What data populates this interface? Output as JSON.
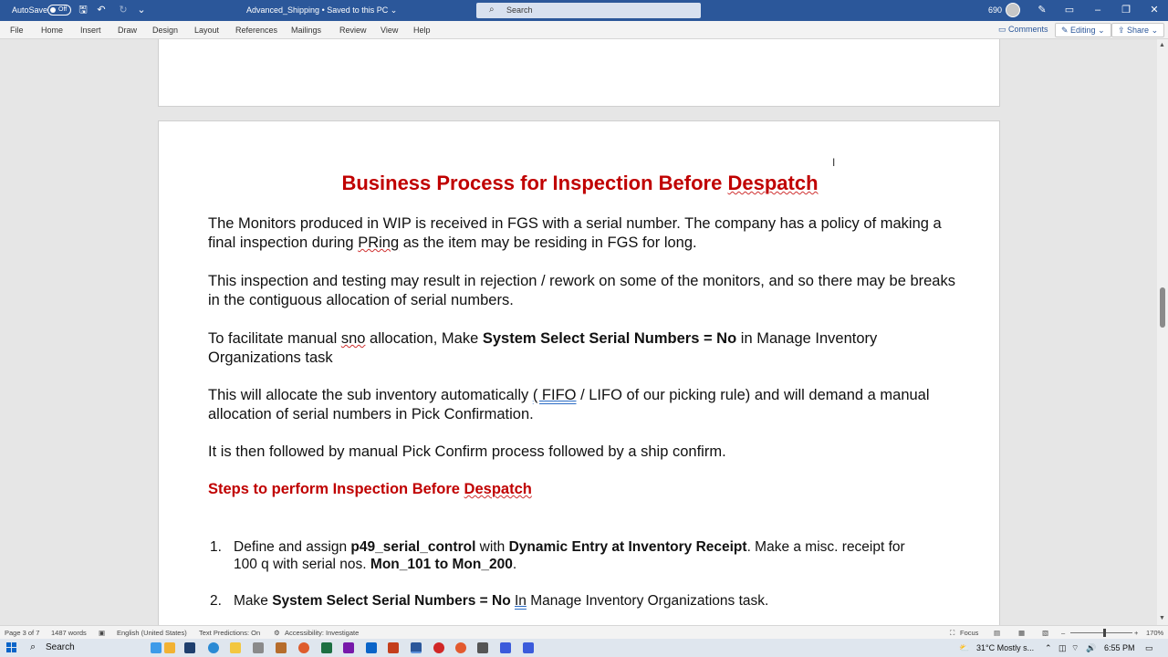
{
  "titlebar": {
    "autosave_label": "AutoSave",
    "autosave_state": "Off",
    "doc_title": "Advanced_Shipping • Saved to this PC ⌄",
    "search_placeholder": "Search",
    "count": "690"
  },
  "ribbon": {
    "tabs": [
      "File",
      "Home",
      "Insert",
      "Draw",
      "Design",
      "Layout",
      "References",
      "Mailings",
      "Review",
      "View",
      "Help"
    ],
    "comments": "Comments",
    "editing": "Editing ⌄",
    "share": "Share ⌄"
  },
  "document": {
    "title_main": "Business Process for Inspection Before ",
    "title_word": "Despatch",
    "p1a": "The Monitors produced in WIP is received in FGS with a serial number. The company has a policy of making a final inspection during ",
    "p1b": "PRing",
    "p1c": " as the item may be residing in FGS for long.",
    "p2": "This inspection and testing may result in rejection / rework on some of the monitors, and so there may be breaks in the contiguous allocation of serial numbers.",
    "p3a": "To facilitate manual ",
    "p3b": "sno",
    "p3c": " allocation, Make ",
    "p3d": "System Select Serial Numbers = No",
    "p3e": " in Manage Inventory Organizations task",
    "p4a": "This will allocate the sub inventory automatically ",
    "p4b": "( FIFO",
    "p4c": " / LIFO of our picking rule) and will demand a manual allocation of serial numbers in Pick Confirmation.",
    "p5": "It is then followed by manual Pick Confirm process followed by a ship confirm.",
    "steps_main": "Steps to perform Inspection Before ",
    "steps_word": "Despatch",
    "step1": {
      "num": "1.",
      "a": "Define and assign ",
      "b": "p49_serial_control",
      "c": " with ",
      "d": "Dynamic Entry at Inventory Receipt",
      "e": ". Make a misc. receipt for 100 q with serial nos. ",
      "f": "Mon_101 to Mon_200",
      "g": "."
    },
    "step2": {
      "num": "2.",
      "a": "Make ",
      "b": "System Select Serial Numbers = No",
      "c": " ",
      "d": "In",
      "e": " Manage Inventory Organizations task."
    }
  },
  "statusbar": {
    "page": "Page 3 of 7",
    "words": "1487 words",
    "language": "English (United States)",
    "predictions": "Text Predictions: On",
    "accessibility": "Accessibility: Investigate",
    "focus": "Focus",
    "zoom": "170%"
  },
  "taskbar": {
    "search": "Search",
    "weather": "31°C  Mostly s...",
    "time": "6:55 PM"
  }
}
